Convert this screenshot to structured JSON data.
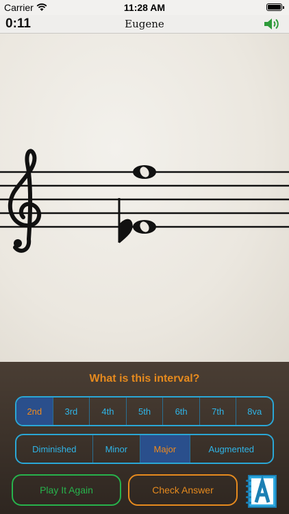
{
  "status": {
    "carrier": "Carrier",
    "time": "11:28 AM"
  },
  "nav": {
    "timer": "0:11",
    "title": "Eugene"
  },
  "icons": {
    "wifi": "wifi-icon",
    "battery": "battery-icon",
    "speaker": "speaker-icon",
    "answer_book": "answer-book-icon",
    "treble_clef": "treble-clef-icon",
    "flat": "flat-icon",
    "whole_note": "whole-note-icon"
  },
  "colors": {
    "accent_orange": "#e68a1e",
    "accent_blue": "#2fb5e8",
    "accent_green": "#27b34c",
    "selected_bg": "#2a4f8c"
  },
  "question": "What is this interval?",
  "interval_numbers": [
    {
      "label": "2nd",
      "selected": true
    },
    {
      "label": "3rd",
      "selected": false
    },
    {
      "label": "4th",
      "selected": false
    },
    {
      "label": "5th",
      "selected": false
    },
    {
      "label": "6th",
      "selected": false
    },
    {
      "label": "7th",
      "selected": false
    },
    {
      "label": "8va",
      "selected": false
    }
  ],
  "interval_qualities": [
    {
      "label": "Diminished",
      "selected": false
    },
    {
      "label": "Minor",
      "selected": false
    },
    {
      "label": "Major",
      "selected": true
    },
    {
      "label": "Augmented",
      "selected": false
    }
  ],
  "buttons": {
    "play_again": "Play It Again",
    "check_answer": "Check Answer"
  }
}
